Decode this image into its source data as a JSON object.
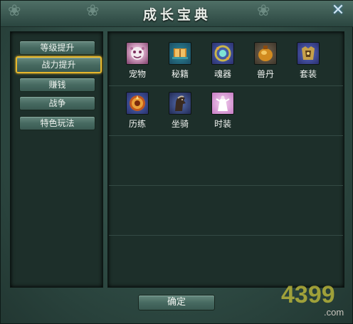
{
  "window": {
    "title": "成长宝典",
    "close_glyph": "✕"
  },
  "sidebar": {
    "items": [
      {
        "label": "等级提升",
        "selected": false
      },
      {
        "label": "战力提升",
        "selected": true
      },
      {
        "label": "赚钱",
        "selected": false
      },
      {
        "label": "战争",
        "selected": false
      },
      {
        "label": "特色玩法",
        "selected": false
      }
    ]
  },
  "grid": {
    "items": [
      {
        "label": "宠物",
        "icon": "pet-icon"
      },
      {
        "label": "秘籍",
        "icon": "book-icon"
      },
      {
        "label": "魂器",
        "icon": "soul-artifact-icon"
      },
      {
        "label": "兽丹",
        "icon": "beast-pill-icon"
      },
      {
        "label": "套装",
        "icon": "armor-set-icon"
      },
      {
        "label": "历练",
        "icon": "training-icon"
      },
      {
        "label": "坐骑",
        "icon": "mount-icon"
      },
      {
        "label": "时装",
        "icon": "fashion-icon"
      }
    ]
  },
  "footer": {
    "confirm_label": "确定"
  },
  "watermark": {
    "text": "4399",
    "suffix": ".com"
  },
  "colors": {
    "selected_border": "#e7b72c",
    "panel_bg": "#1d2f2a",
    "frame_bg": "#2e4a43"
  }
}
